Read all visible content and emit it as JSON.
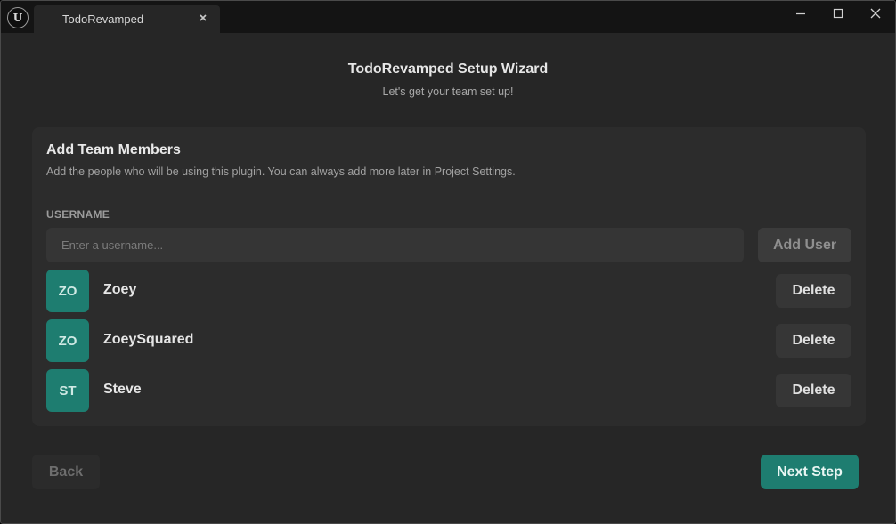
{
  "window": {
    "tab_title": "TodoRevamped",
    "logo_letter": "U"
  },
  "wizard": {
    "title": "TodoRevamped Setup Wizard",
    "subtitle": "Let's get your team set up!"
  },
  "panel": {
    "title": "Add Team Members",
    "description": "Add the people who will be using this plugin. You can always add more later in Project Settings.",
    "field_label": "USERNAME",
    "input_value": "",
    "input_placeholder": "Enter a username...",
    "add_user_label": "Add User",
    "users": [
      {
        "initials": "ZO",
        "name": "Zoey",
        "delete_label": "Delete"
      },
      {
        "initials": "ZO",
        "name": "ZoeySquared",
        "delete_label": "Delete"
      },
      {
        "initials": "ST",
        "name": "Steve",
        "delete_label": "Delete"
      }
    ]
  },
  "footer": {
    "back_label": "Back",
    "next_label": "Next Step"
  },
  "colors": {
    "accent": "#1e7d70",
    "background": "#262626",
    "panel": "#2c2c2c",
    "titlebar": "#141414"
  },
  "icons": {
    "logo": "unreal-engine-logo-icon",
    "tab_close": "close-icon",
    "minimize": "minimize-icon",
    "maximize": "maximize-icon",
    "close": "close-icon"
  }
}
